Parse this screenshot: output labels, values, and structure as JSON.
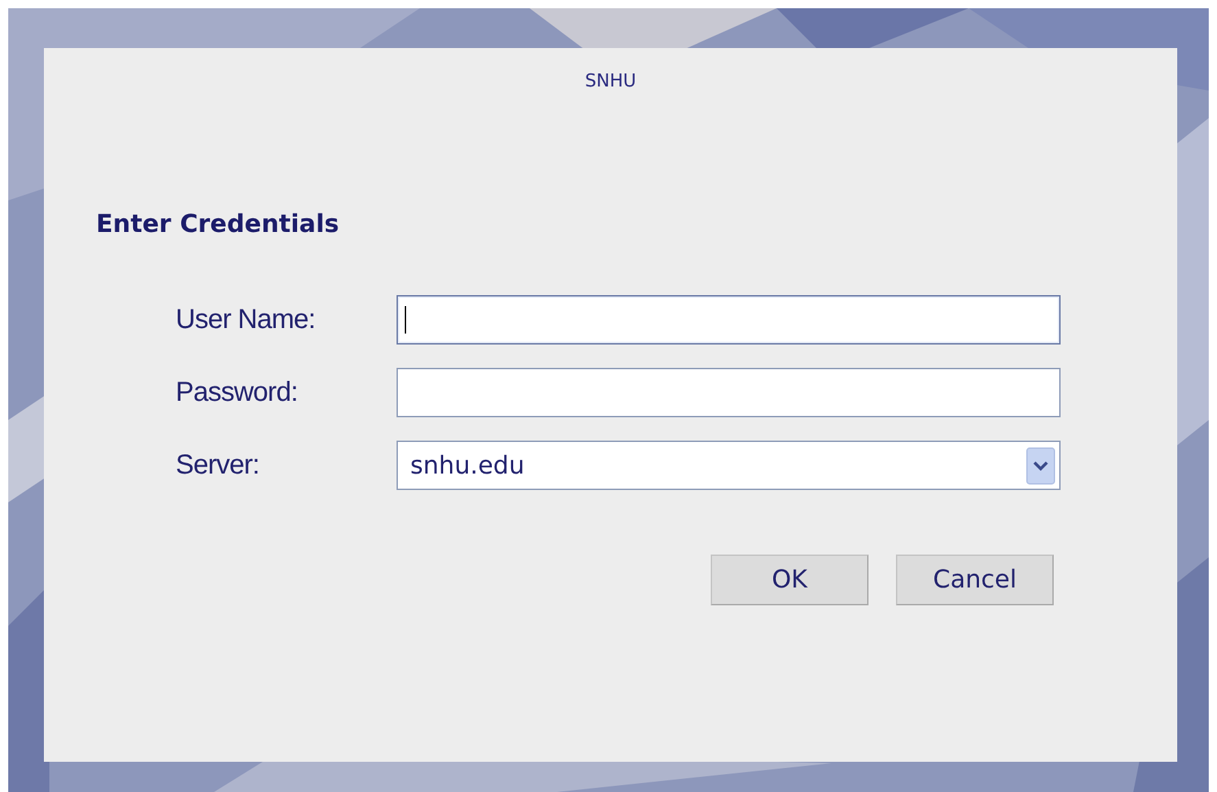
{
  "dialog": {
    "header": "SNHU",
    "title": "Enter Credentials",
    "fields": [
      {
        "kind": "text",
        "label": "User Name:",
        "focused": true
      },
      {
        "kind": "password",
        "label": "Password:",
        "focused": false
      },
      {
        "kind": "select",
        "label": "Server:",
        "value": "snhu.edu",
        "focused": false
      }
    ],
    "buttons": [
      "OK",
      "Cancel"
    ]
  }
}
